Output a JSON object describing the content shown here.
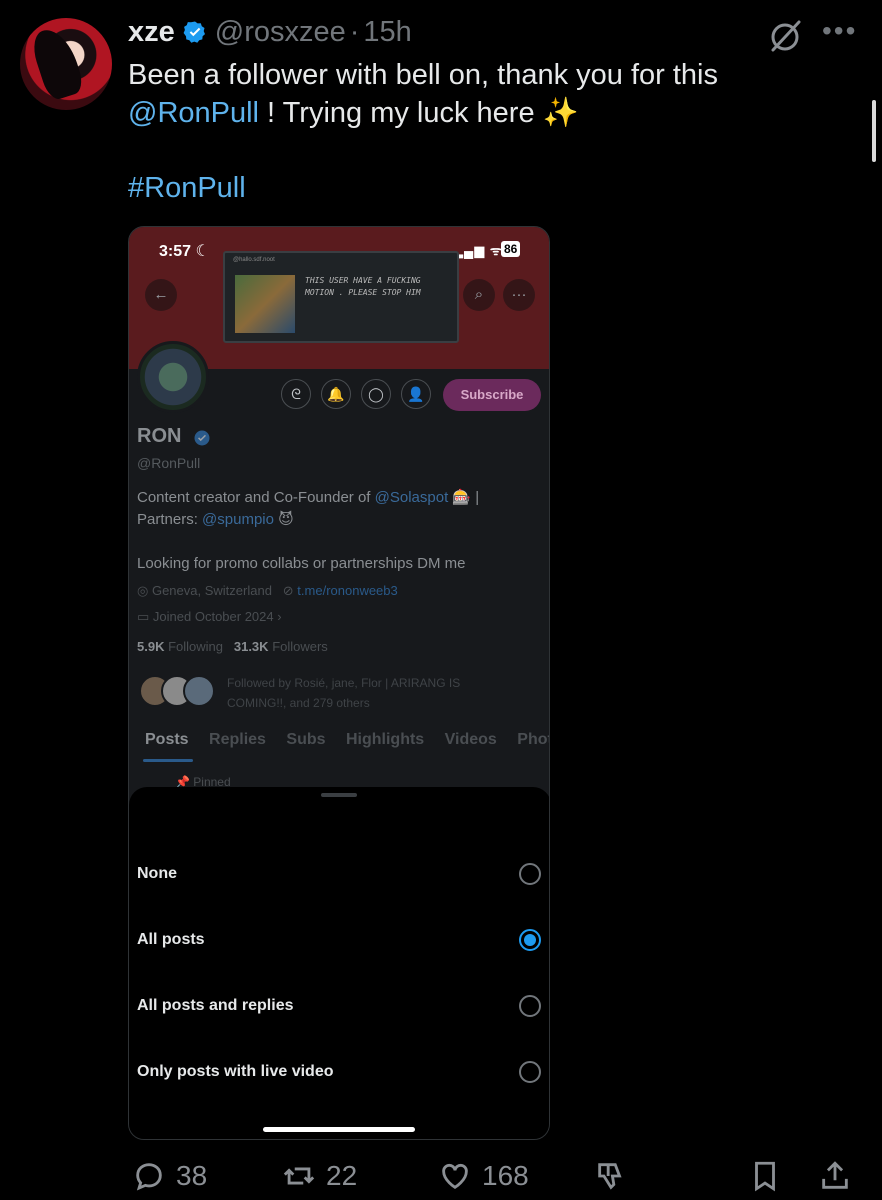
{
  "author": {
    "name": "xze",
    "handle": "@rosxzee",
    "separator": "·",
    "time": "15h"
  },
  "tweet": {
    "line1": "Been a follower with bell on, thank you for this",
    "mention": "@RonPull",
    "line2_rest": " ! Trying my luck here",
    "sparkles": "✨",
    "hashtag": "#RonPull"
  },
  "embedded": {
    "status_time": "3:57",
    "battery": "86",
    "note_label": "@hallo.sdf.noot",
    "note_text": "THIS USER HAVE A FUCKING MOTION . PLEASE STOP HIM",
    "subscribe_label": "Subscribe",
    "profile_name": "RON",
    "profile_handle": "@RonPull",
    "bio_prefix": "Content creator and Co-Founder of ",
    "bio_link1": "@Solaspot",
    "bio_mid": " 🎰 | Partners: ",
    "bio_link2": "@spumpio",
    "bio_suffix": " 😈",
    "bio2": "Looking for promo collabs or partnerships DM me",
    "location": "Geneva, Switzerland",
    "url": "t.me/rononweeb3",
    "joined": "Joined October 2024",
    "following_count": "5.9K",
    "following_label": "Following",
    "followers_count": "31.3K",
    "followers_label": "Followers",
    "followed_by": "Followed by Rosié, jane, Flor | ARIRANG IS COMING!!, and 279 others",
    "tabs": [
      "Posts",
      "Replies",
      "Subs",
      "Highlights",
      "Videos",
      "Photo"
    ],
    "pinned": "Pinned",
    "options": [
      {
        "label": "None",
        "selected": false
      },
      {
        "label": "All posts",
        "selected": true
      },
      {
        "label": "All posts and replies",
        "selected": false
      },
      {
        "label": "Only posts with live video",
        "selected": false
      }
    ]
  },
  "actions": {
    "replies": "38",
    "reposts": "22",
    "likes": "168"
  },
  "colors": {
    "accent": "#1d9bf0",
    "link": "#5fb3ec",
    "muted": "#71767b"
  }
}
